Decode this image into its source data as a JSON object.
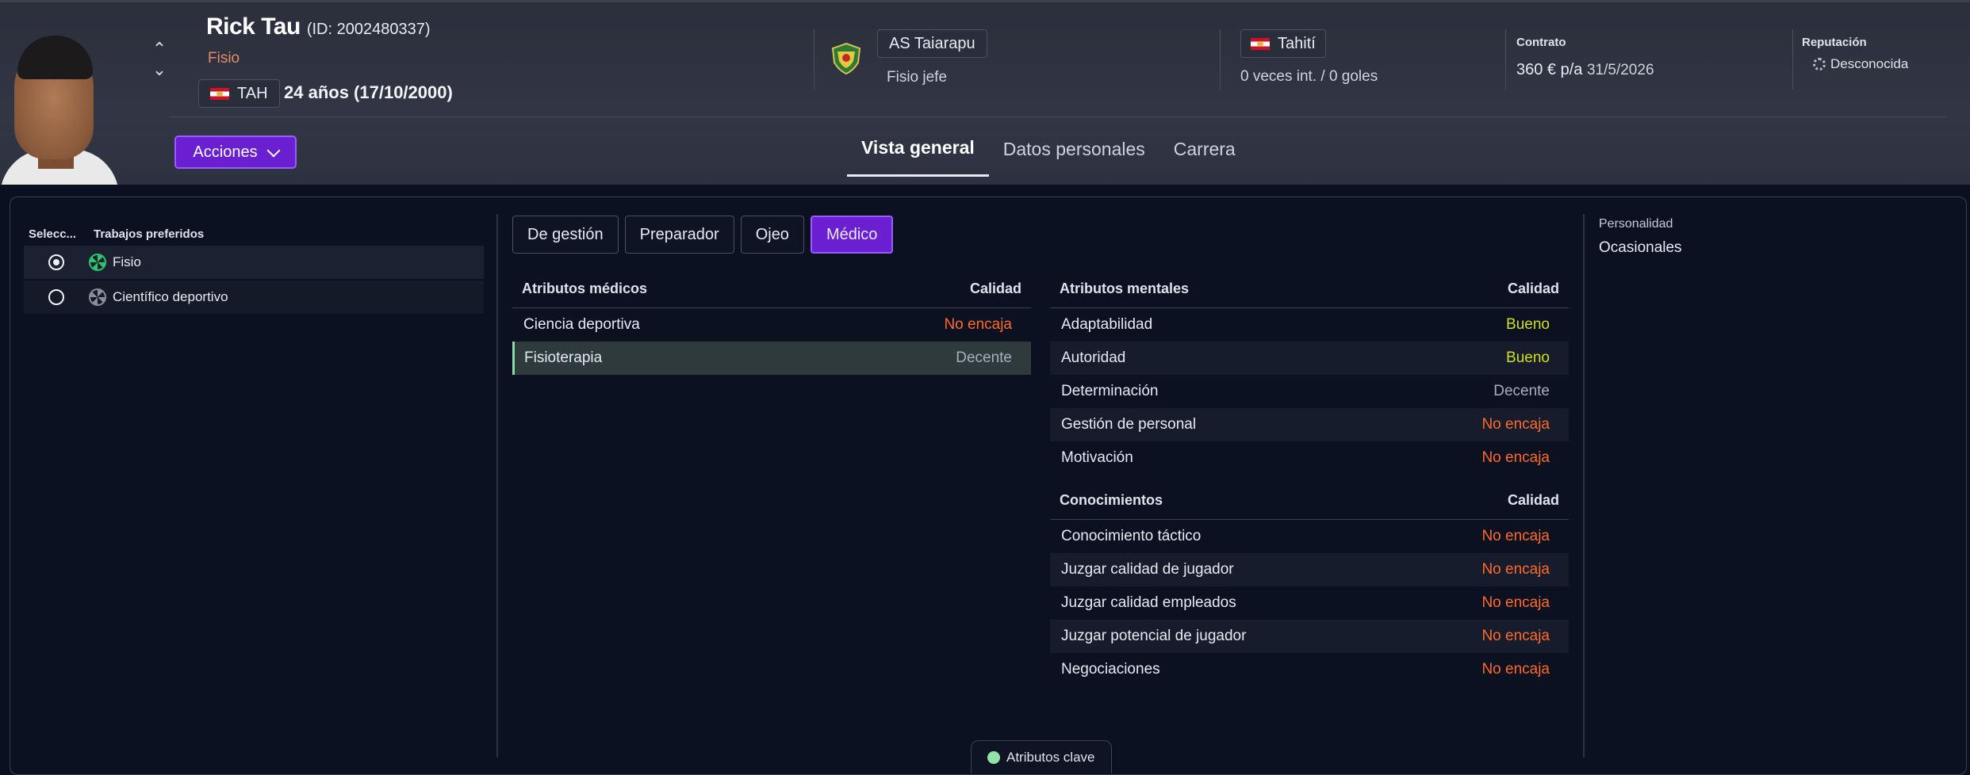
{
  "profile": {
    "name": "Rick Tau",
    "id_text": "(ID: 2002480337)",
    "role": "Fisio",
    "nation_code": "TAH",
    "age_text": "24 años (17/10/2000)",
    "actions_label": "Acciones"
  },
  "club": {
    "name": "AS Taiarapu",
    "job": "Fisio jefe"
  },
  "nation": {
    "name": "Tahití",
    "caps": "0 veces int. / 0 goles"
  },
  "contract": {
    "label": "Contrato",
    "wage": "360 € p/a",
    "expiry": "31/5/2026"
  },
  "reputation": {
    "label": "Reputación",
    "value": "Desconocida"
  },
  "tabs": [
    "Vista general",
    "Datos personales",
    "Carrera"
  ],
  "jobs": {
    "col_select": "Selecc...",
    "col_jobs": "Trabajos preferidos",
    "rows": [
      {
        "label": "Fisio",
        "selected": true
      },
      {
        "label": "Científico deportivo",
        "selected": false
      }
    ]
  },
  "subtabs": [
    "De gestión",
    "Preparador",
    "Ojeo",
    "Médico"
  ],
  "medical": {
    "title": "Atributos médicos",
    "col": "Calidad",
    "rows": [
      {
        "name": "Ciencia deportiva",
        "quality": "No encaja"
      },
      {
        "name": "Fisioterapia",
        "quality": "Decente"
      }
    ]
  },
  "mental": {
    "title": "Atributos mentales",
    "col": "Calidad",
    "rows": [
      {
        "name": "Adaptabilidad",
        "quality": "Bueno"
      },
      {
        "name": "Autoridad",
        "quality": "Bueno"
      },
      {
        "name": "Determinación",
        "quality": "Decente"
      },
      {
        "name": "Gestión de personal",
        "quality": "No encaja"
      },
      {
        "name": "Motivación",
        "quality": "No encaja"
      }
    ]
  },
  "knowledge": {
    "title": "Conocimientos",
    "col": "Calidad",
    "rows": [
      {
        "name": "Conocimiento táctico",
        "quality": "No encaja"
      },
      {
        "name": "Juzgar calidad de jugador",
        "quality": "No encaja"
      },
      {
        "name": "Juzgar calidad empleados",
        "quality": "No encaja"
      },
      {
        "name": "Juzgar potencial de jugador",
        "quality": "No encaja"
      },
      {
        "name": "Negociaciones",
        "quality": "No encaja"
      }
    ]
  },
  "personality": {
    "label": "Personalidad",
    "value": "Ocasionales"
  },
  "key_attributes_label": "Atributos clave",
  "colors": {
    "accent": "#6a1fd0",
    "quality_poor": "#ff6a2b",
    "quality_good": "#d2df21",
    "quality_ok": "#a8adb8"
  }
}
